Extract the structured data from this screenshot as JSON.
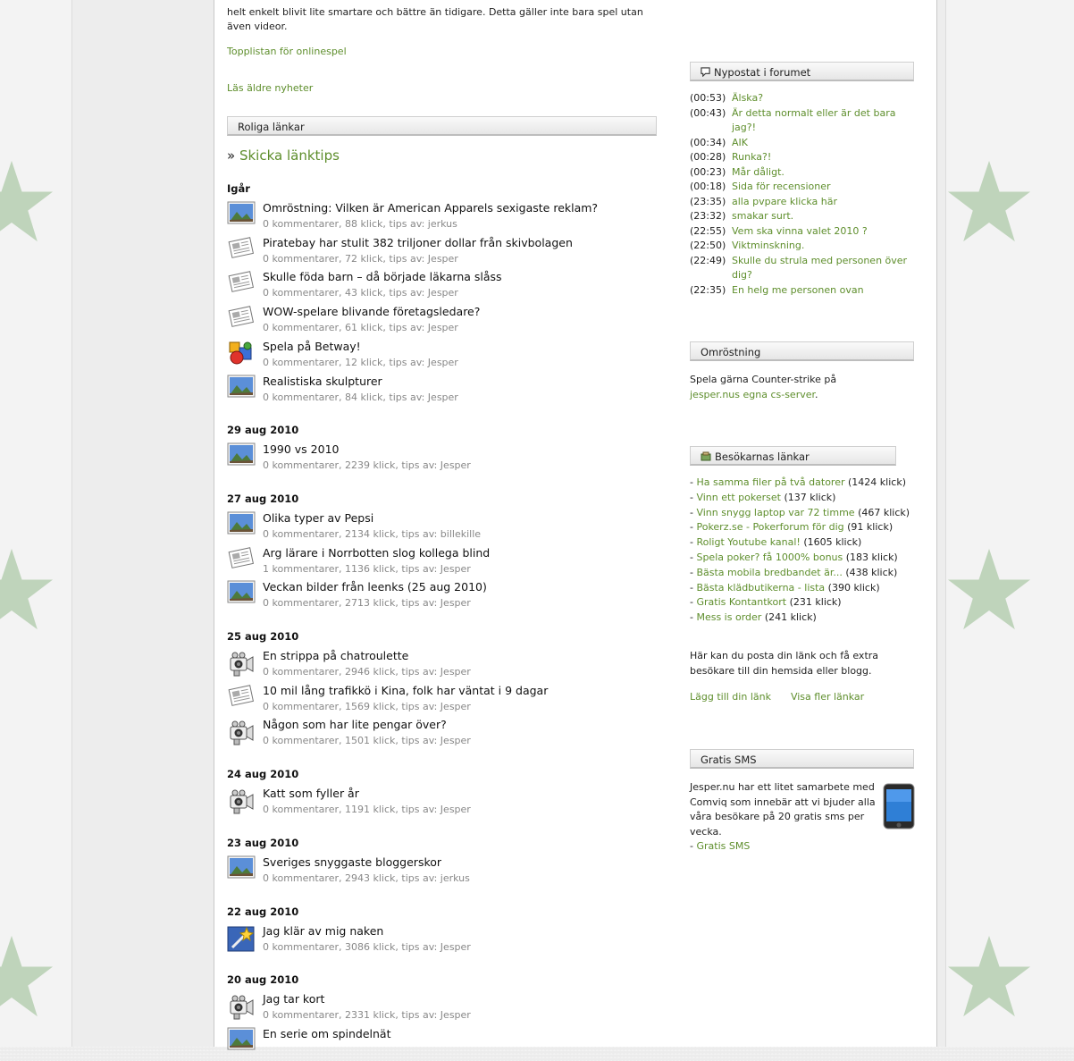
{
  "intro": {
    "line1": "helt enkelt blivit lite smartare och bättre än tidigare. Detta gäller inte bara spel utan",
    "line2": "även videor.",
    "toplist": "Topplistan för onlinespel",
    "older": "Läs äldre nyheter"
  },
  "fun_links": {
    "title": "Roliga länkar",
    "send_prefix": "»",
    "send_label": "Skicka länktips",
    "groups": [
      {
        "date": "Igår",
        "items": [
          {
            "icon": "landscape-icon",
            "title": "Omröstning: Vilken är American Apparels sexigaste reklam?",
            "meta": "0 kommentarer, 88 klick, tips av: jerkus"
          },
          {
            "icon": "newspaper-icon",
            "title": "Piratebay har stulit 382 triljoner dollar från skivbolagen",
            "meta": "0 kommentarer, 72 klick, tips av: Jesper"
          },
          {
            "icon": "newspaper-icon",
            "title": "Skulle föda barn – då började läkarna slåss",
            "meta": "0 kommentarer, 43 klick, tips av: Jesper"
          },
          {
            "icon": "newspaper-icon",
            "title": "WOW-spelare blivande företagsledare?",
            "meta": "0 kommentarer, 61 klick, tips av: Jesper"
          },
          {
            "icon": "games-icon",
            "title": "Spela på Betway!",
            "meta": "0 kommentarer, 12 klick, tips av: Jesper"
          },
          {
            "icon": "landscape-icon",
            "title": "Realistiska skulpturer",
            "meta": "0 kommentarer, 84 klick, tips av: Jesper"
          }
        ]
      },
      {
        "date": "29 aug 2010",
        "items": [
          {
            "icon": "landscape-icon",
            "title": "1990 vs 2010",
            "meta": "0 kommentarer, 2239 klick, tips av: Jesper"
          }
        ]
      },
      {
        "date": "27 aug 2010",
        "items": [
          {
            "icon": "landscape-icon",
            "title": "Olika typer av Pepsi",
            "meta": "0 kommentarer, 2134 klick, tips av: billekille"
          },
          {
            "icon": "newspaper-icon",
            "title": "Arg lärare i Norrbotten slog kollega blind",
            "meta": "1 kommentarer, 1136 klick, tips av: Jesper"
          },
          {
            "icon": "landscape-icon",
            "title": "Veckan bilder från leenks (25 aug 2010)",
            "meta": "0 kommentarer, 2713 klick, tips av: Jesper"
          }
        ]
      },
      {
        "date": "25 aug 2010",
        "items": [
          {
            "icon": "camera-icon",
            "title": "En strippa på chatroulette",
            "meta": "0 kommentarer, 2946 klick, tips av: Jesper"
          },
          {
            "icon": "newspaper-icon",
            "title": "10 mil lång trafikkö i Kina, folk har väntat i 9 dagar",
            "meta": "0 kommentarer, 1569 klick, tips av: Jesper"
          },
          {
            "icon": "camera-icon",
            "title": "Någon som har lite pengar över?",
            "meta": "0 kommentarer, 1501 klick, tips av: Jesper"
          }
        ]
      },
      {
        "date": "24 aug 2010",
        "items": [
          {
            "icon": "camera-icon",
            "title": "Katt som fyller år",
            "meta": "0 kommentarer, 1191 klick, tips av: Jesper"
          }
        ]
      },
      {
        "date": "23 aug 2010",
        "items": [
          {
            "icon": "landscape-icon",
            "title": "Sveriges snyggaste bloggerskor",
            "meta": "0 kommentarer, 2943 klick, tips av: jerkus"
          }
        ]
      },
      {
        "date": "22 aug 2010",
        "items": [
          {
            "icon": "magic-wand-icon",
            "title": "Jag klär av mig naken",
            "meta": "0 kommentarer, 3086 klick, tips av: Jesper"
          }
        ]
      },
      {
        "date": "20 aug 2010",
        "items": [
          {
            "icon": "camera-icon",
            "title": "Jag tar kort",
            "meta": "0 kommentarer, 2331 klick, tips av: Jesper"
          },
          {
            "icon": "landscape-icon",
            "title": "En serie om spindelnät",
            "meta": ""
          }
        ]
      }
    ]
  },
  "forum": {
    "title": "Nypostat i forumet",
    "posts": [
      {
        "time": "(00:53)",
        "text": "Älska?"
      },
      {
        "time": "(00:43)",
        "text": "Är detta normalt eller är det bara jag?!"
      },
      {
        "time": "(00:34)",
        "text": "AIK"
      },
      {
        "time": "(00:28)",
        "text": "Runka?!"
      },
      {
        "time": "(00:23)",
        "text": "Mår dåligt."
      },
      {
        "time": "(00:18)",
        "text": "Sida för recensioner"
      },
      {
        "time": "(23:35)",
        "text": "alla pvpare klicka här"
      },
      {
        "time": "(23:32)",
        "text": "smakar surt."
      },
      {
        "time": "(22:55)",
        "text": "Vem ska vinna valet 2010 ?"
      },
      {
        "time": "(22:50)",
        "text": "Viktminskning."
      },
      {
        "time": "(22:49)",
        "text": "Skulle du strula med personen över dig?"
      },
      {
        "time": "(22:35)",
        "text": "En helg me personen ovan"
      }
    ]
  },
  "poll": {
    "title": "Omröstning",
    "text": "Spela gärna Counter-strike på",
    "link": "jesper.nus egna cs-server",
    "suffix": "."
  },
  "visitor_links": {
    "title": "Besökarnas länkar",
    "items": [
      {
        "label": "Ha samma filer på två datorer",
        "clicks": "(1424 klick)"
      },
      {
        "label": "Vinn ett pokerset",
        "clicks": "(137 klick)"
      },
      {
        "label": "Vinn snygg laptop var 72 timme",
        "clicks": "(467 klick)"
      },
      {
        "label": "Pokerz.se - Pokerforum för dig",
        "clicks": "(91 klick)"
      },
      {
        "label": "Roligt Youtube kanal!",
        "clicks": "(1605 klick)"
      },
      {
        "label": "Spela poker? få 1000% bonus",
        "clicks": "(183 klick)"
      },
      {
        "label": "Bästa mobila bredbandet är...",
        "clicks": "(438 klick)"
      },
      {
        "label": "Bästa klädbutikerna - lista",
        "clicks": "(390 klick)"
      },
      {
        "label": "Gratis Kontantkort",
        "clicks": "(231 klick)"
      },
      {
        "label": "Mess is order",
        "clicks": "(241 klick)"
      }
    ],
    "info": "Här kan du posta din länk och få extra besökare till din hemsida eller blogg.",
    "add_link": "Lägg till din länk",
    "more_link": "Visa fler länkar"
  },
  "sms": {
    "title": "Gratis SMS",
    "text": "Jesper.nu har ett litet samarbete med Comviq som innebär att vi bjuder alla våra besökare på 20 gratis sms per vecka.",
    "link": "Gratis SMS"
  },
  "colors": {
    "link": "#5e8e2c",
    "star": "#bcd3b8",
    "meta": "#888888"
  }
}
